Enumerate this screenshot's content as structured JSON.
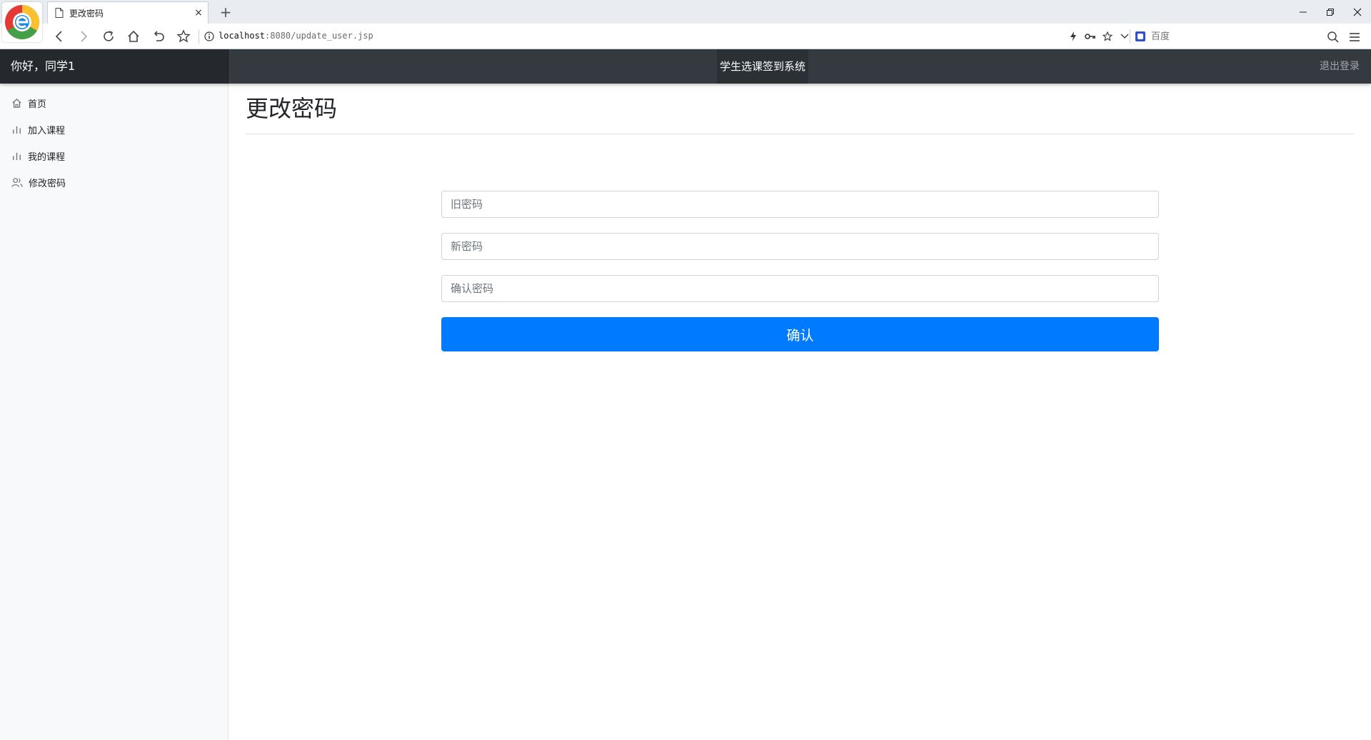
{
  "browser": {
    "tab_title": "更改密码",
    "tab_close": "×",
    "new_tab": "+",
    "address_host": "localhost",
    "address_path": ":8080/update_user.jsp",
    "search_placeholder": "百度",
    "window_minimize": "—",
    "window_restore": "❐",
    "window_close": "✕"
  },
  "navbar": {
    "greeting": "你好，同学1",
    "system_title": "学生选课签到系统",
    "logout": "退出登录",
    "background_color": "#343a40"
  },
  "sidebar": {
    "items": [
      {
        "label": "首页",
        "icon": "home-icon"
      },
      {
        "label": "加入课程",
        "icon": "bar-chart-icon"
      },
      {
        "label": "我的课程",
        "icon": "bar-chart-icon"
      },
      {
        "label": "修改密码",
        "icon": "users-icon"
      }
    ]
  },
  "main": {
    "title": "更改密码",
    "form": {
      "old_password_placeholder": "旧密码",
      "new_password_placeholder": "新密码",
      "confirm_password_placeholder": "确认密码",
      "submit_label": "确认",
      "submit_color": "#007bff"
    }
  }
}
